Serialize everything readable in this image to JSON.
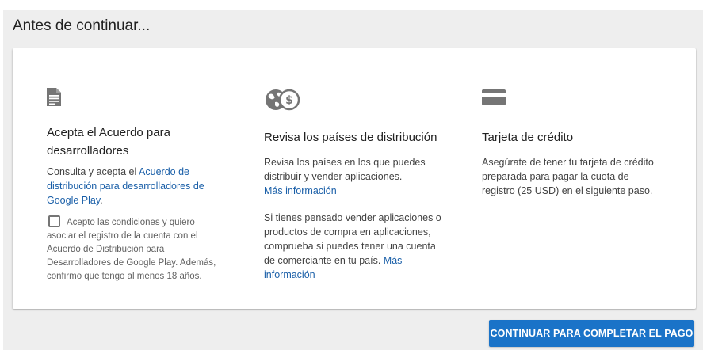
{
  "page": {
    "title": "Antes de continuar..."
  },
  "agreement": {
    "icon": "document-icon",
    "heading": "Acepta el Acuerdo para desarrolladores",
    "text_prefix": "Consulta y acepta el ",
    "link": "Acuerdo de distribución para desarrolladores de Google Play",
    "text_suffix": ".",
    "consent_text": "Acepto las condiciones y quiero asociar el registro de la cuenta con el Acuerdo de Distribución para Desarrolladores de Google Play. Además, confirmo que tengo al menos 18 años.",
    "checkbox_checked": false
  },
  "distribution": {
    "icon": "globe-dollar-icon",
    "heading": "Revisa los países de distribución",
    "p1_text": "Revisa los países en los que puedes distribuir y vender aplicaciones.",
    "p1_link": "Más información",
    "p2_text": "Si tienes pensado vender aplicaciones o productos de compra en aplicaciones, comprueba si puedes tener una cuenta de comerciante en tu país. ",
    "p2_link": "Más información"
  },
  "credit_card": {
    "icon": "credit-card-icon",
    "heading": "Tarjeta de crédito",
    "text": "Asegúrate de tener tu tarjeta de crédito preparada para pagar la cuota de registro (25 USD) en el siguiente paso."
  },
  "actions": {
    "continue_label": "CONTINUAR PARA COMPLETAR EL PAGO"
  },
  "colors": {
    "accent": "#1a73c8",
    "link": "#1a5fa8",
    "background": "#eeeeee",
    "icon": "#757575"
  }
}
